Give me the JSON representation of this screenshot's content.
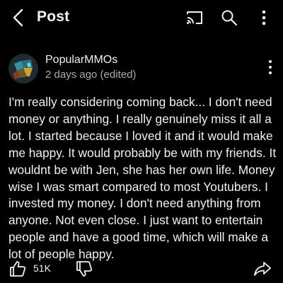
{
  "header": {
    "title": "Post",
    "icons": [
      "back-arrow-icon",
      "cast-icon",
      "search-icon",
      "more-vertical-icon"
    ]
  },
  "post": {
    "author": "PopularMMOs",
    "timestamp": "2 days ago (edited)",
    "body": "I'm really considering coming back... I don't need money or anything. I really genuinely miss it all a lot. I started because I loved it and it would make me happy. It would probably be with my friends. It wouldnt be with Jen, she has her own life. Money wise I was smart compared to most Youtubers. I invested my money. I don't need anything from anyone. Not even close. I just want to entertain people and have a good time, which will make a lot of people happy.",
    "like_count": "51K"
  },
  "colors": {
    "background": "#000000",
    "primary_text": "#f1f1f1",
    "secondary_text": "#aaaaaa"
  }
}
